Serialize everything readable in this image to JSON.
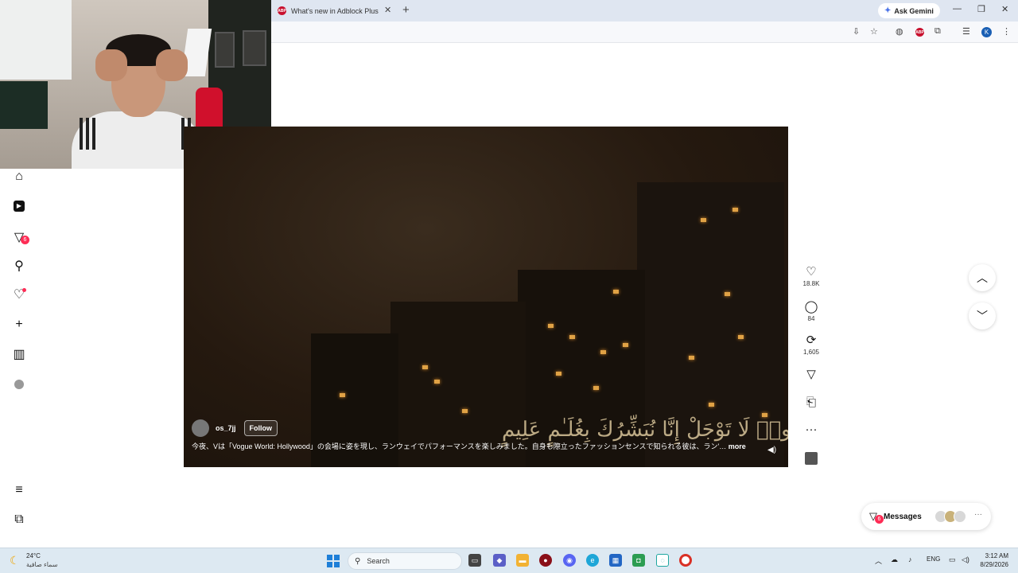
{
  "browser": {
    "tab_title": "What's new in Adblock Plus",
    "tab_favicon": "ABP",
    "gemini_label": "Ask Gemini",
    "profile_initial": "K"
  },
  "nav": {
    "items": [
      {
        "name": "home-icon",
        "glyph": "⌂"
      },
      {
        "name": "following-icon",
        "glyph": "▶"
      },
      {
        "name": "inbox-icon",
        "glyph": "▽",
        "badge": "6"
      },
      {
        "name": "search-icon",
        "glyph": "⚲"
      },
      {
        "name": "activity-icon",
        "glyph": "♡"
      },
      {
        "name": "upload-icon",
        "glyph": "+"
      },
      {
        "name": "studio-icon",
        "glyph": "▥"
      },
      {
        "name": "profile-icon",
        "glyph": "●"
      }
    ],
    "bottom": [
      {
        "name": "menu-icon",
        "glyph": "≡"
      },
      {
        "name": "more-icon",
        "glyph": "⧉"
      }
    ]
  },
  "video": {
    "username": "os_7jj",
    "follow_label": "Follow",
    "caption": "今夜、Vは「Vogue World: Hollywood」の会場に姿を現し、ランウェイでパフォーマンスを楽しみました。自身も際立ったファッションセンスで知られる彼は、ラン'…",
    "more_label": "more",
    "overlay_text": "قَالُوا۟ لَا تَوْجَلْ إِنَّا نُبَشِّرُكَ بِغُلَـٰمٍ عَلِيمٍ"
  },
  "actions": {
    "likes": "18.8K",
    "comments": "84",
    "reposts": "1,605"
  },
  "messages": {
    "label": "Messages",
    "badge": "6"
  },
  "taskbar": {
    "temp": "24°C",
    "weather_desc": "سماء صافية",
    "search_placeholder": "Search",
    "lang": "ENG",
    "time": "3:12 AM",
    "date": "8/29/2026"
  }
}
